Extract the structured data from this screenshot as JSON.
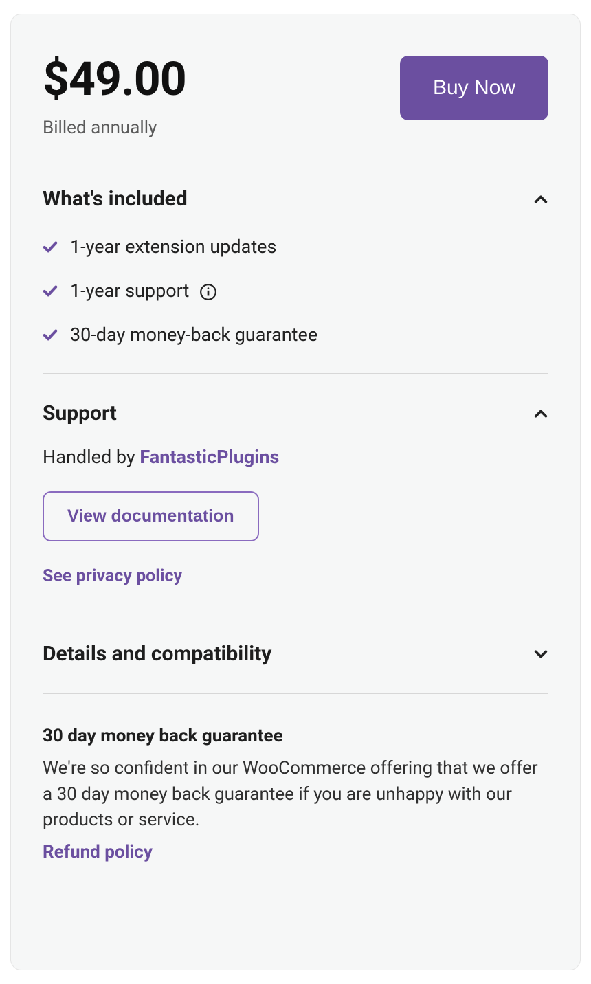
{
  "pricing": {
    "price": "$49.00",
    "billing_note": "Billed annually",
    "buy_label": "Buy Now"
  },
  "included": {
    "heading": "What's included",
    "items": [
      "1-year extension updates",
      "1-year support",
      "30-day money-back guarantee"
    ],
    "support_has_info_icon": true
  },
  "support": {
    "heading": "Support",
    "handled_by_prefix": "Handled by ",
    "vendor": "FantasticPlugins",
    "docs_label": "View documentation",
    "privacy_label": "See privacy policy"
  },
  "details": {
    "heading": "Details and compatibility"
  },
  "guarantee": {
    "title": "30 day money back guarantee",
    "body": "We're so confident in our WooCommerce offering that we offer a 30 day money back guarantee if you are unhappy with our products or service.",
    "refund_label": "Refund policy"
  },
  "icons": {
    "check_color": "#6b4fa0",
    "chev_color": "#222222"
  }
}
